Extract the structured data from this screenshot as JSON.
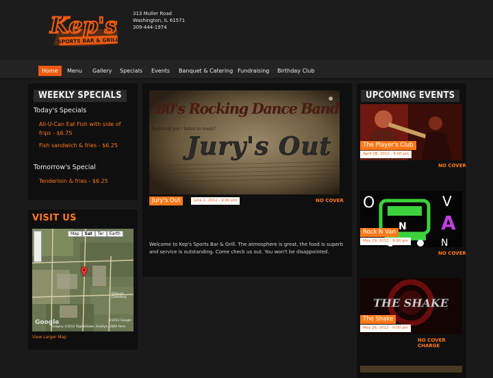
{
  "header": {
    "logo_name": "Kep's",
    "logo_sub": "SPORTS BAR & GRILL",
    "address_line1": "313 Muller Road",
    "address_line2": "Washington, IL 61571",
    "phone": "309-444-1974"
  },
  "nav": {
    "items": [
      "Home",
      "Menu",
      "Gallery",
      "Specials",
      "Events",
      "Banquet & Catering",
      "Fundraising",
      "Birthday Club"
    ],
    "active": "Home"
  },
  "specials": {
    "title": "WEEKLY SPECIALS",
    "today_heading": "Today's Specials",
    "today_items": [
      "All-U-Can Eat Fish with side of frips - $6.75",
      "Fish sandwich & fries - $6.25"
    ],
    "tomorrow_heading": "Tomorrow's Special",
    "tomorrow_items": [
      "Tenderloin & fries - $6.25"
    ]
  },
  "visit": {
    "title": "VISIT US",
    "map_tabs": [
      "Map",
      "Sat",
      "Ter",
      "Earth"
    ],
    "map_label": "Dalouss Cemetery",
    "map_copyright": "©2012 Google",
    "map_credits": "Imagery ©2012 DigitalGlobe, GeoEye, USDA Farm",
    "map_google": "Google",
    "larger_map": "View Larger Map"
  },
  "feature": {
    "banner_line1": "80's Rocking Dance Band",
    "banner_line2": "Jury's Out",
    "banner_small": "by lots of you / listen to music!",
    "event_name": "Jury's Out",
    "date": "June 1, 2012 - 9:00 pm",
    "cover": "NO COVER",
    "welcome": "Welcome to Kep's Sports Bar & Grill. The atmosphere is great, the food is superb and service is outstanding. Come check us out. You won't be disappointed."
  },
  "events": {
    "title": "UPCOMING EVENTS",
    "list": [
      {
        "name": "The Player's Club",
        "date": "April 28, 2012 - 9:00 pm",
        "cover": "NO COVER"
      },
      {
        "name": "Rock N Van",
        "date": "May 19, 2012 - 9:00 pm",
        "cover": "NO COVER"
      },
      {
        "name": "The Shake",
        "date": "May 26, 2012 - 9:00 pm",
        "cover": "NO COVER CHARGE"
      }
    ],
    "shake_logo": "THE SHAKE"
  },
  "colors": {
    "accent": "#ff7a1a",
    "accent_dark": "#ee5a10",
    "background": "#1a1a1a",
    "panel": "#0f0f0f"
  }
}
